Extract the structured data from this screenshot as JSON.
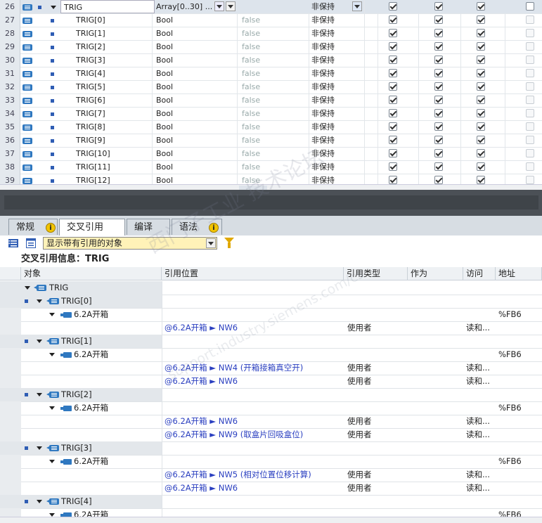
{
  "db_table": {
    "parent": {
      "num": "26",
      "name": "TRIG",
      "type": "Array[0..30] ...",
      "retain": "非保持"
    },
    "rows": [
      {
        "num": "27",
        "name": "TRIG[0]",
        "type": "Bool",
        "default": "false",
        "retain": "非保持"
      },
      {
        "num": "28",
        "name": "TRIG[1]",
        "type": "Bool",
        "default": "false",
        "retain": "非保持"
      },
      {
        "num": "29",
        "name": "TRIG[2]",
        "type": "Bool",
        "default": "false",
        "retain": "非保持"
      },
      {
        "num": "30",
        "name": "TRIG[3]",
        "type": "Bool",
        "default": "false",
        "retain": "非保持"
      },
      {
        "num": "31",
        "name": "TRIG[4]",
        "type": "Bool",
        "default": "false",
        "retain": "非保持"
      },
      {
        "num": "32",
        "name": "TRIG[5]",
        "type": "Bool",
        "default": "false",
        "retain": "非保持"
      },
      {
        "num": "33",
        "name": "TRIG[6]",
        "type": "Bool",
        "default": "false",
        "retain": "非保持"
      },
      {
        "num": "34",
        "name": "TRIG[7]",
        "type": "Bool",
        "default": "false",
        "retain": "非保持"
      },
      {
        "num": "35",
        "name": "TRIG[8]",
        "type": "Bool",
        "default": "false",
        "retain": "非保持"
      },
      {
        "num": "36",
        "name": "TRIG[9]",
        "type": "Bool",
        "default": "false",
        "retain": "非保持"
      },
      {
        "num": "37",
        "name": "TRIG[10]",
        "type": "Bool",
        "default": "false",
        "retain": "非保持"
      },
      {
        "num": "38",
        "name": "TRIG[11]",
        "type": "Bool",
        "default": "false",
        "retain": "非保持"
      },
      {
        "num": "39",
        "name": "TRIG[12]",
        "type": "Bool",
        "default": "false",
        "retain": "非保持"
      }
    ]
  },
  "tabs": [
    {
      "label": "常规",
      "info": "i"
    },
    {
      "label": "交叉引用"
    },
    {
      "label": "编译"
    },
    {
      "label": "语法",
      "info": "i"
    }
  ],
  "toolbar": {
    "filter_value": "显示带有引用的对象"
  },
  "xref": {
    "title": "交叉引用信息：TRIG",
    "columns": [
      "对象",
      "引用位置",
      "引用类型",
      "作为",
      "访问",
      "地址"
    ],
    "root": "TRIG",
    "groups": [
      {
        "object": "TRIG[0]",
        "block": "6.2A开箱",
        "address": "%FB6",
        "refs": [
          {
            "location": "@6.2A开箱 ► NW6",
            "type": "使用者",
            "access": "读和..."
          }
        ]
      },
      {
        "object": "TRIG[1]",
        "block": "6.2A开箱",
        "address": "%FB6",
        "refs": [
          {
            "location": "@6.2A开箱 ► NW4 (开箱接箱真空开)",
            "type": "使用者",
            "access": "读和..."
          },
          {
            "location": "@6.2A开箱 ► NW6",
            "type": "使用者",
            "access": "读和..."
          }
        ]
      },
      {
        "object": "TRIG[2]",
        "block": "6.2A开箱",
        "address": "%FB6",
        "refs": [
          {
            "location": "@6.2A开箱 ► NW6",
            "type": "使用者",
            "access": "读和..."
          },
          {
            "location": "@6.2A开箱 ► NW9 (取盒片回吸盒位)",
            "type": "使用者",
            "access": "读和..."
          }
        ]
      },
      {
        "object": "TRIG[3]",
        "block": "6.2A开箱",
        "address": "%FB6",
        "refs": [
          {
            "location": "@6.2A开箱 ► NW5 (相对位置位移计算)",
            "type": "使用者",
            "access": "读和..."
          },
          {
            "location": "@6.2A开箱 ► NW6",
            "type": "使用者",
            "access": "读和..."
          }
        ]
      },
      {
        "object": "TRIG[4]",
        "block": "6.2A开箱",
        "address": "%FB6",
        "refs": []
      }
    ]
  },
  "watermark": {
    "line1": "西门子工业 技术论坛",
    "line2": "support.industry.siemens.com/cs"
  }
}
